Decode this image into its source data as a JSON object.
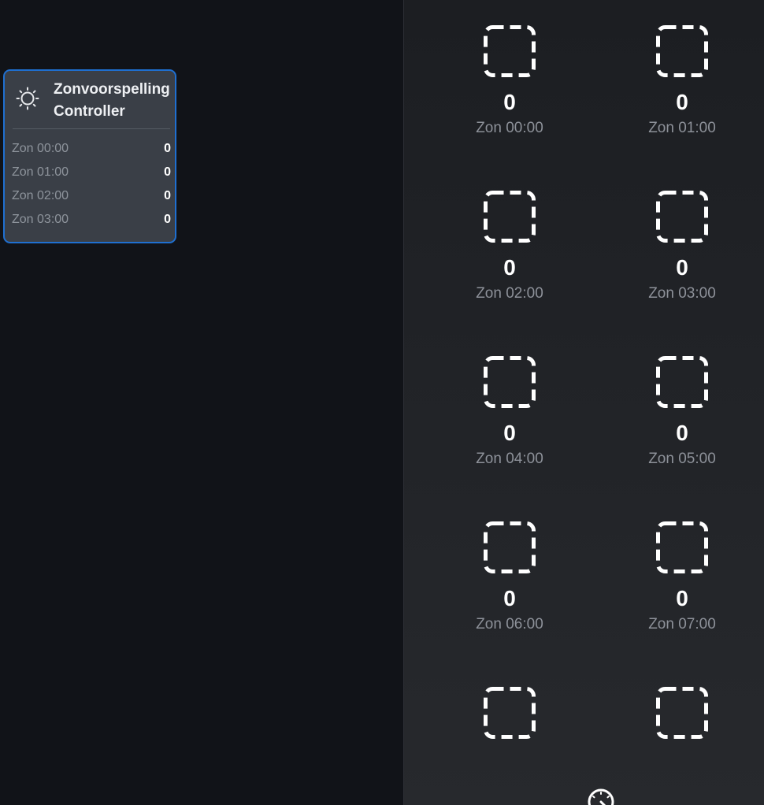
{
  "controller": {
    "title_line1": "Zonvoorspelling",
    "title_line2": "Controller",
    "icon": "sun-icon",
    "rows": [
      {
        "label": "Zon 00:00",
        "value": "0"
      },
      {
        "label": "Zon 01:00",
        "value": "0"
      },
      {
        "label": "Zon 02:00",
        "value": "0"
      },
      {
        "label": "Zon 03:00",
        "value": "0"
      }
    ]
  },
  "tiles": [
    {
      "label": "Zon 00:00",
      "value": "0",
      "icon": "dashed-square-icon"
    },
    {
      "label": "Zon 01:00",
      "value": "0",
      "icon": "dashed-square-icon"
    },
    {
      "label": "Zon 02:00",
      "value": "0",
      "icon": "dashed-square-icon"
    },
    {
      "label": "Zon 03:00",
      "value": "0",
      "icon": "dashed-square-icon"
    },
    {
      "label": "Zon 04:00",
      "value": "0",
      "icon": "dashed-square-icon"
    },
    {
      "label": "Zon 05:00",
      "value": "0",
      "icon": "dashed-square-icon"
    },
    {
      "label": "Zon 06:00",
      "value": "0",
      "icon": "dashed-square-icon"
    },
    {
      "label": "Zon 07:00",
      "value": "0",
      "icon": "dashed-square-icon"
    },
    {
      "label": "",
      "value": "",
      "icon": "dashed-square-icon"
    },
    {
      "label": "",
      "value": "",
      "icon": "dashed-square-icon"
    }
  ],
  "bottom_icon": "gauge-icon",
  "colors": {
    "accent": "#1f6fd0",
    "card_bg": "#3a3f47",
    "page_bg": "#111318"
  }
}
